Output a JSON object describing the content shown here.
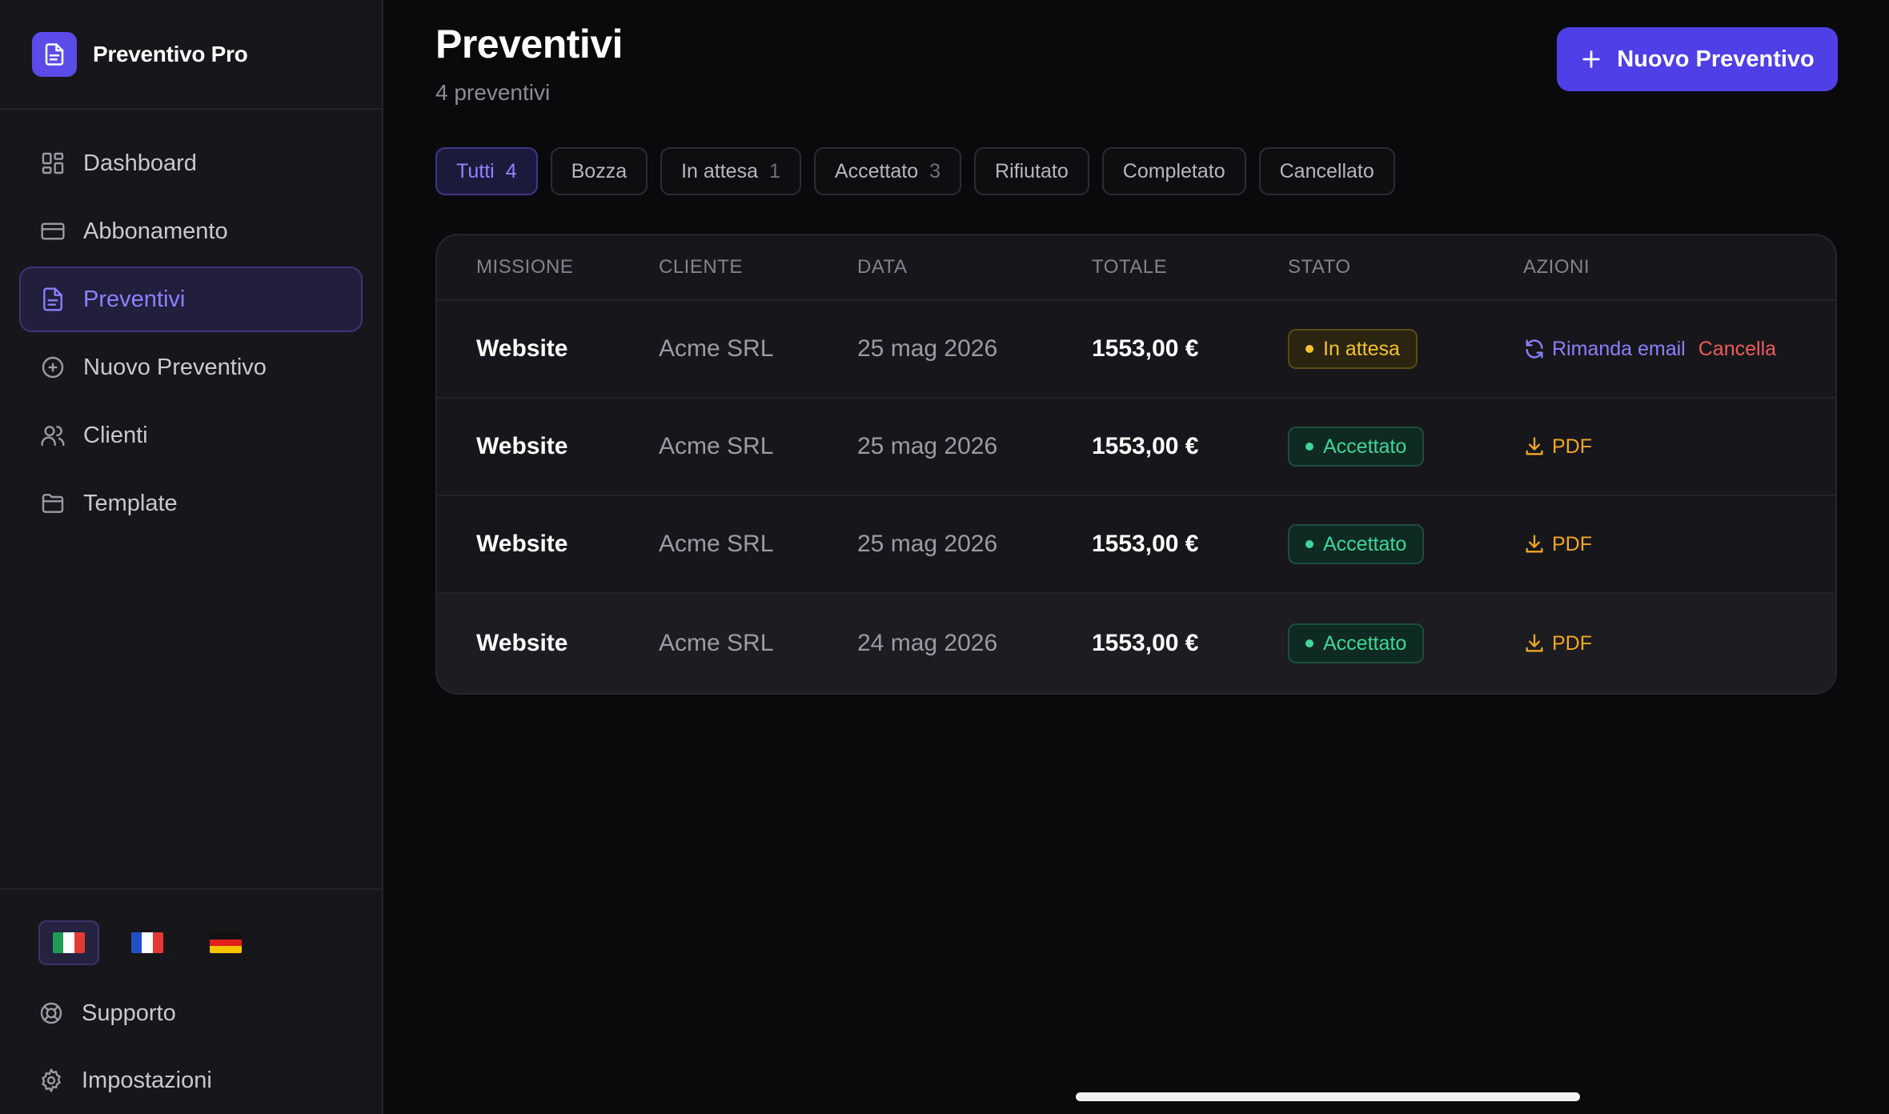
{
  "app": {
    "name": "Preventivo Pro"
  },
  "sidebar": {
    "items": [
      {
        "label": "Dashboard",
        "icon": "dashboard-icon"
      },
      {
        "label": "Abbonamento",
        "icon": "credit-card-icon"
      },
      {
        "label": "Preventivi",
        "icon": "document-icon",
        "active": true
      },
      {
        "label": "Nuovo Preventivo",
        "icon": "plus-circle-icon"
      },
      {
        "label": "Clienti",
        "icon": "users-icon"
      },
      {
        "label": "Template",
        "icon": "folder-icon"
      }
    ],
    "languages": [
      "it",
      "fr",
      "de"
    ],
    "active_language": "it",
    "support_label": "Supporto",
    "settings_label": "Impostazioni"
  },
  "header": {
    "title": "Preventivi",
    "subtitle": "4 preventivi",
    "new_button_label": "Nuovo Preventivo"
  },
  "filters": [
    {
      "label": "Tutti",
      "count": "4",
      "active": true
    },
    {
      "label": "Bozza",
      "count": ""
    },
    {
      "label": "In attesa",
      "count": "1"
    },
    {
      "label": "Accettato",
      "count": "3"
    },
    {
      "label": "Rifiutato",
      "count": ""
    },
    {
      "label": "Completato",
      "count": ""
    },
    {
      "label": "Cancellato",
      "count": ""
    }
  ],
  "table": {
    "columns": [
      "MISSIONE",
      "CLIENTE",
      "DATA",
      "TOTALE",
      "STATO",
      "AZIONI"
    ],
    "rows": [
      {
        "mission": "Website",
        "client": "Acme SRL",
        "date": "25 mag 2026",
        "total": "1553,00 €",
        "status": "In attesa",
        "status_type": "pending",
        "actions": [
          "Rimanda email",
          "Cancella"
        ]
      },
      {
        "mission": "Website",
        "client": "Acme SRL",
        "date": "25 mag 2026",
        "total": "1553,00 €",
        "status": "Accettato",
        "status_type": "accepted",
        "actions": [
          "PDF"
        ]
      },
      {
        "mission": "Website",
        "client": "Acme SRL",
        "date": "25 mag 2026",
        "total": "1553,00 €",
        "status": "Accettato",
        "status_type": "accepted",
        "actions": [
          "PDF"
        ]
      },
      {
        "mission": "Website",
        "client": "Acme SRL",
        "date": "24 mag 2026",
        "total": "1553,00 €",
        "status": "Accettato",
        "status_type": "accepted",
        "actions": [
          "PDF"
        ]
      }
    ]
  },
  "colors": {
    "accent": "#4f3fe6",
    "pending": "#f5c22b",
    "accepted": "#3ed69a",
    "danger": "#f05a5a",
    "pdf": "#f4a623"
  }
}
